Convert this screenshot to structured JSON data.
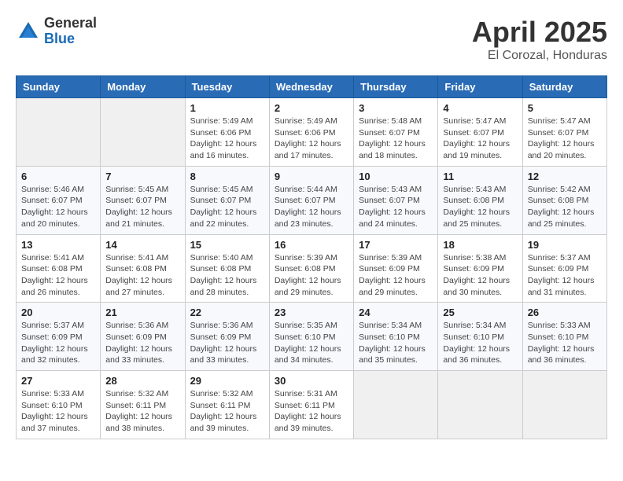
{
  "logo": {
    "general": "General",
    "blue": "Blue"
  },
  "title": "April 2025",
  "location": "El Corozal, Honduras",
  "days_of_week": [
    "Sunday",
    "Monday",
    "Tuesday",
    "Wednesday",
    "Thursday",
    "Friday",
    "Saturday"
  ],
  "weeks": [
    [
      {
        "day": "",
        "info": ""
      },
      {
        "day": "",
        "info": ""
      },
      {
        "day": "1",
        "info": "Sunrise: 5:49 AM\nSunset: 6:06 PM\nDaylight: 12 hours and 16 minutes."
      },
      {
        "day": "2",
        "info": "Sunrise: 5:49 AM\nSunset: 6:06 PM\nDaylight: 12 hours and 17 minutes."
      },
      {
        "day": "3",
        "info": "Sunrise: 5:48 AM\nSunset: 6:07 PM\nDaylight: 12 hours and 18 minutes."
      },
      {
        "day": "4",
        "info": "Sunrise: 5:47 AM\nSunset: 6:07 PM\nDaylight: 12 hours and 19 minutes."
      },
      {
        "day": "5",
        "info": "Sunrise: 5:47 AM\nSunset: 6:07 PM\nDaylight: 12 hours and 20 minutes."
      }
    ],
    [
      {
        "day": "6",
        "info": "Sunrise: 5:46 AM\nSunset: 6:07 PM\nDaylight: 12 hours and 20 minutes."
      },
      {
        "day": "7",
        "info": "Sunrise: 5:45 AM\nSunset: 6:07 PM\nDaylight: 12 hours and 21 minutes."
      },
      {
        "day": "8",
        "info": "Sunrise: 5:45 AM\nSunset: 6:07 PM\nDaylight: 12 hours and 22 minutes."
      },
      {
        "day": "9",
        "info": "Sunrise: 5:44 AM\nSunset: 6:07 PM\nDaylight: 12 hours and 23 minutes."
      },
      {
        "day": "10",
        "info": "Sunrise: 5:43 AM\nSunset: 6:07 PM\nDaylight: 12 hours and 24 minutes."
      },
      {
        "day": "11",
        "info": "Sunrise: 5:43 AM\nSunset: 6:08 PM\nDaylight: 12 hours and 25 minutes."
      },
      {
        "day": "12",
        "info": "Sunrise: 5:42 AM\nSunset: 6:08 PM\nDaylight: 12 hours and 25 minutes."
      }
    ],
    [
      {
        "day": "13",
        "info": "Sunrise: 5:41 AM\nSunset: 6:08 PM\nDaylight: 12 hours and 26 minutes."
      },
      {
        "day": "14",
        "info": "Sunrise: 5:41 AM\nSunset: 6:08 PM\nDaylight: 12 hours and 27 minutes."
      },
      {
        "day": "15",
        "info": "Sunrise: 5:40 AM\nSunset: 6:08 PM\nDaylight: 12 hours and 28 minutes."
      },
      {
        "day": "16",
        "info": "Sunrise: 5:39 AM\nSunset: 6:08 PM\nDaylight: 12 hours and 29 minutes."
      },
      {
        "day": "17",
        "info": "Sunrise: 5:39 AM\nSunset: 6:09 PM\nDaylight: 12 hours and 29 minutes."
      },
      {
        "day": "18",
        "info": "Sunrise: 5:38 AM\nSunset: 6:09 PM\nDaylight: 12 hours and 30 minutes."
      },
      {
        "day": "19",
        "info": "Sunrise: 5:37 AM\nSunset: 6:09 PM\nDaylight: 12 hours and 31 minutes."
      }
    ],
    [
      {
        "day": "20",
        "info": "Sunrise: 5:37 AM\nSunset: 6:09 PM\nDaylight: 12 hours and 32 minutes."
      },
      {
        "day": "21",
        "info": "Sunrise: 5:36 AM\nSunset: 6:09 PM\nDaylight: 12 hours and 33 minutes."
      },
      {
        "day": "22",
        "info": "Sunrise: 5:36 AM\nSunset: 6:09 PM\nDaylight: 12 hours and 33 minutes."
      },
      {
        "day": "23",
        "info": "Sunrise: 5:35 AM\nSunset: 6:10 PM\nDaylight: 12 hours and 34 minutes."
      },
      {
        "day": "24",
        "info": "Sunrise: 5:34 AM\nSunset: 6:10 PM\nDaylight: 12 hours and 35 minutes."
      },
      {
        "day": "25",
        "info": "Sunrise: 5:34 AM\nSunset: 6:10 PM\nDaylight: 12 hours and 36 minutes."
      },
      {
        "day": "26",
        "info": "Sunrise: 5:33 AM\nSunset: 6:10 PM\nDaylight: 12 hours and 36 minutes."
      }
    ],
    [
      {
        "day": "27",
        "info": "Sunrise: 5:33 AM\nSunset: 6:10 PM\nDaylight: 12 hours and 37 minutes."
      },
      {
        "day": "28",
        "info": "Sunrise: 5:32 AM\nSunset: 6:11 PM\nDaylight: 12 hours and 38 minutes."
      },
      {
        "day": "29",
        "info": "Sunrise: 5:32 AM\nSunset: 6:11 PM\nDaylight: 12 hours and 39 minutes."
      },
      {
        "day": "30",
        "info": "Sunrise: 5:31 AM\nSunset: 6:11 PM\nDaylight: 12 hours and 39 minutes."
      },
      {
        "day": "",
        "info": ""
      },
      {
        "day": "",
        "info": ""
      },
      {
        "day": "",
        "info": ""
      }
    ]
  ]
}
